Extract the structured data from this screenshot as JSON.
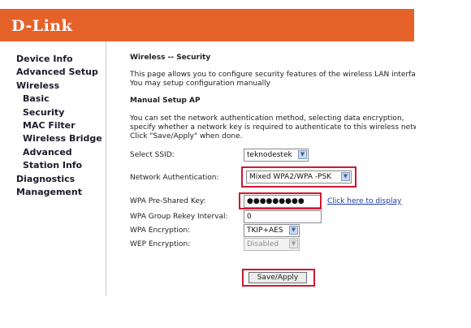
{
  "brand": {
    "logo_text": "D-Link"
  },
  "nav": {
    "items": [
      {
        "label": "Device Info"
      },
      {
        "label": "Advanced Setup"
      },
      {
        "label": "Wireless"
      },
      {
        "label": "Basic"
      },
      {
        "label": "Security"
      },
      {
        "label": "MAC Filter"
      },
      {
        "label": "Wireless Bridge"
      },
      {
        "label": "Advanced"
      },
      {
        "label": "Station Info"
      },
      {
        "label": "Diagnostics"
      },
      {
        "label": "Management"
      }
    ]
  },
  "page": {
    "title": "Wireless -- Security",
    "intro_line1": "This page allows you to configure security features of the wireless LAN interface.",
    "intro_line2": "You may setup configuration manually",
    "section_title": "Manual Setup AP",
    "desc_line1": "You can set the network authentication method, selecting data encryption,",
    "desc_line2": "specify whether a network key is required to authenticate to this wireless network",
    "desc_line3": "Click \"Save/Apply\" when done."
  },
  "form": {
    "ssid": {
      "label": "Select SSID:",
      "value": "teknodestek"
    },
    "auth": {
      "label": "Network Authentication:",
      "value": "Mixed WPA2/WPA -PSK"
    },
    "psk": {
      "label": "WPA Pre-Shared Key:",
      "value": "●●●●●●●●●",
      "link": "Click here to display"
    },
    "rekey": {
      "label": "WPA Group Rekey Interval:",
      "value": "0"
    },
    "encryption": {
      "label": "WPA Encryption:",
      "value": "TKIP+AES"
    },
    "wep": {
      "label": "WEP Encryption:",
      "value": "Disabled"
    },
    "save_label": "Save/Apply"
  },
  "colors": {
    "header": "#e5622b",
    "highlight": "#d01830",
    "link": "#1f3aa8"
  }
}
